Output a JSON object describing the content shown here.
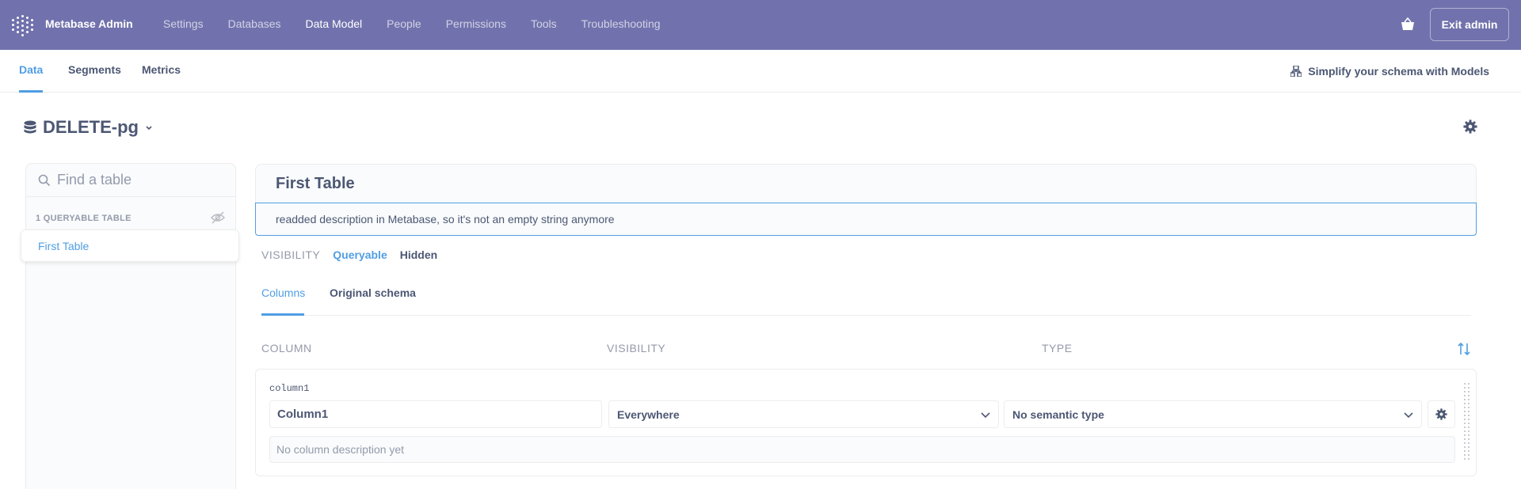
{
  "topnav": {
    "brand": "Metabase Admin",
    "links": [
      "Settings",
      "Databases",
      "Data Model",
      "People",
      "Permissions",
      "Tools",
      "Troubleshooting"
    ],
    "active_link": "Data Model",
    "exit_label": "Exit admin",
    "bg_color": "#7172ad"
  },
  "subnav": {
    "tabs": [
      "Data",
      "Segments",
      "Metrics"
    ],
    "active_tab": "Data",
    "simplify_label": "Simplify your schema with Models"
  },
  "database": {
    "name": "DELETE-pg"
  },
  "sidebar": {
    "search_placeholder": "Find a table",
    "section_label": "1 QUERYABLE TABLE",
    "tables": [
      "First Table"
    ]
  },
  "table": {
    "title": "First Table",
    "description": "readded description in Metabase, so it's not an empty string anymore",
    "visibility_label": "VISIBILITY",
    "visibility_options": [
      "Queryable",
      "Hidden"
    ],
    "visibility_selected": "Queryable",
    "tabs": [
      "Columns",
      "Original schema"
    ],
    "active_tab": "Columns"
  },
  "columns": {
    "headers": {
      "column": "COLUMN",
      "visibility": "VISIBILITY",
      "type": "TYPE"
    },
    "rows": [
      {
        "raw_name": "column1",
        "display_name": "Column1",
        "visibility": "Everywhere",
        "semantic_type": "No semantic type",
        "description_placeholder": "No column description yet"
      }
    ]
  },
  "colors": {
    "brand": "#509ee3",
    "text": "#4c5773",
    "muted": "#949aab",
    "border": "#eeecec"
  }
}
